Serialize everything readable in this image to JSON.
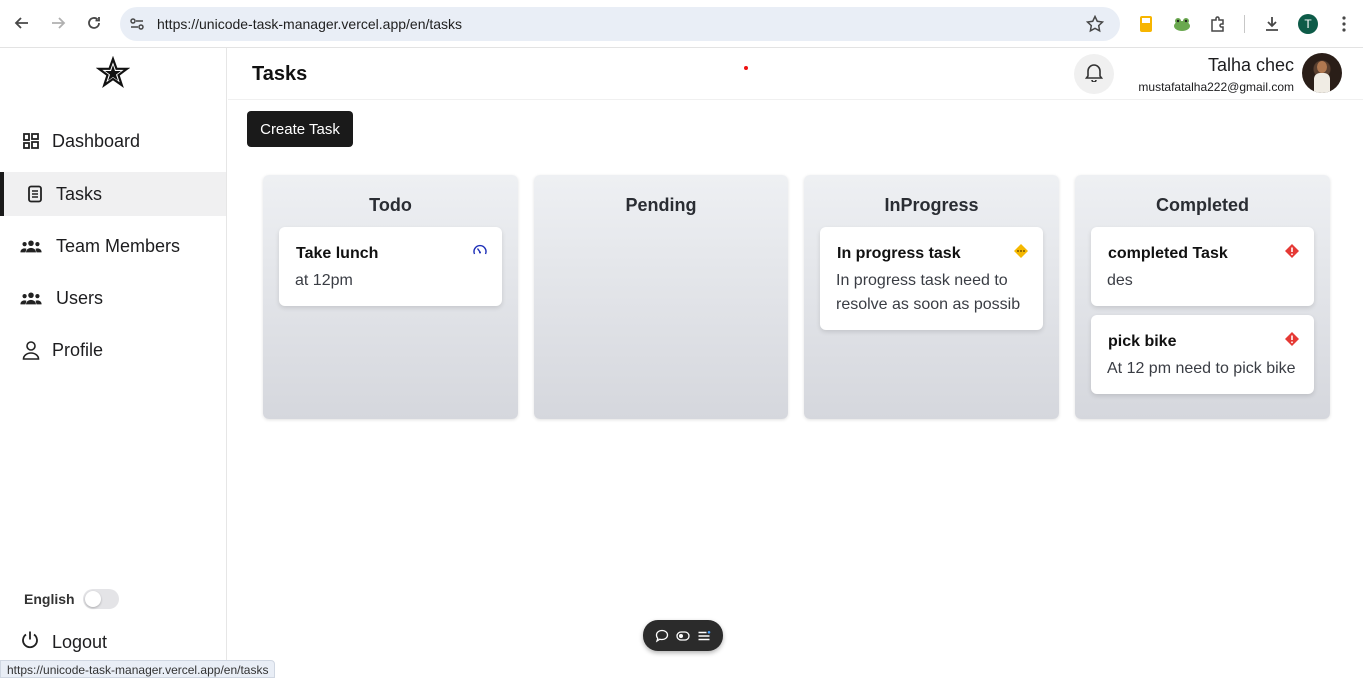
{
  "browser": {
    "url": "https://unicode-task-manager.vercel.app/en/tasks",
    "profile_initial": "T",
    "status_url": "https://unicode-task-manager.vercel.app/en/tasks"
  },
  "sidebar": {
    "items": [
      {
        "label": "Dashboard",
        "icon": "dashboard-icon"
      },
      {
        "label": "Tasks",
        "icon": "tasks-icon",
        "active": true
      },
      {
        "label": "Team Members",
        "icon": "team-icon"
      },
      {
        "label": "Users",
        "icon": "users-icon"
      },
      {
        "label": "Profile",
        "icon": "person-icon"
      }
    ],
    "language_label": "English",
    "logout_label": "Logout"
  },
  "header": {
    "title": "Tasks",
    "user_name": "Talha chec",
    "user_email": "mustafatalha222@gmail.com"
  },
  "main": {
    "create_button_label": "Create Task",
    "columns": [
      {
        "title": "Todo",
        "cards": [
          {
            "title": "Take lunch",
            "description": "at 12pm",
            "priority": "low",
            "priority_color": "#1d2fb8"
          }
        ]
      },
      {
        "title": "Pending",
        "cards": []
      },
      {
        "title": "InProgress",
        "cards": [
          {
            "title": "In progress task",
            "description_line1": "In progress task need to",
            "description_line2": "resolve as soon as possib",
            "priority": "medium",
            "priority_color": "#f5b800"
          }
        ]
      },
      {
        "title": "Completed",
        "cards": [
          {
            "title": "completed Task",
            "description": "des",
            "priority": "high",
            "priority_color": "#e53935"
          },
          {
            "title": "pick bike",
            "description": "At 12 pm need to pick bike",
            "priority": "high",
            "priority_color": "#e53935"
          }
        ]
      }
    ]
  },
  "colors": {
    "primary_button": "#1a1a1a",
    "column_gradient_top": "#eef0f3",
    "column_gradient_bottom": "#d5d7dd"
  }
}
